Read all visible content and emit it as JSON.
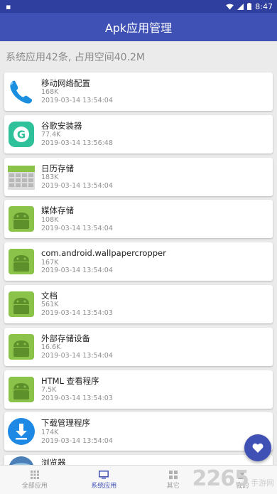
{
  "status_bar": {
    "time": "8:47",
    "wifi_icon": "wifi-icon",
    "signal_icon": "signal-icon",
    "battery_icon": "battery-icon"
  },
  "app_bar": {
    "title": "Apk应用管理"
  },
  "summary": {
    "text": "系统应用42条, 占用空间40.2M"
  },
  "apps": [
    {
      "name": "移动网络配置",
      "size": "168K",
      "date": "2019-03-14 13:54:04",
      "icon": "phone-icon"
    },
    {
      "name": "谷歌安装器",
      "size": "77.4K",
      "date": "2019-03-14 13:56:48",
      "icon": "google-installer-icon"
    },
    {
      "name": "日历存储",
      "size": "183K",
      "date": "2019-03-14 13:54:04",
      "icon": "calendar-icon"
    },
    {
      "name": "媒体存储",
      "size": "108K",
      "date": "2019-03-14 13:54:04",
      "icon": "android-icon"
    },
    {
      "name": "com.android.wallpapercropper",
      "size": "167K",
      "date": "2019-03-14 13:54:04",
      "icon": "android-icon"
    },
    {
      "name": "文档",
      "size": "561K",
      "date": "2019-03-14 13:54:03",
      "icon": "android-icon"
    },
    {
      "name": "外部存储设备",
      "size": "16.6K",
      "date": "2019-03-14 13:54:04",
      "icon": "android-icon"
    },
    {
      "name": "HTML 查看程序",
      "size": "7.5K",
      "date": "2019-03-14 13:54:03",
      "icon": "android-icon"
    },
    {
      "name": "下载管理程序",
      "size": "174K",
      "date": "2019-03-14 13:54:04",
      "icon": "download-icon"
    },
    {
      "name": "浏览器",
      "size": "",
      "date": "",
      "icon": "browser-icon"
    }
  ],
  "bottom_nav": {
    "tab1": "全部应用",
    "tab2": "系统应用",
    "tab3": "其它",
    "tab4": "我的"
  },
  "colors": {
    "primary": "#3f51b5",
    "android_green": "#8bc34a"
  },
  "watermark": {
    "big": "2265",
    "small": "手游网"
  }
}
